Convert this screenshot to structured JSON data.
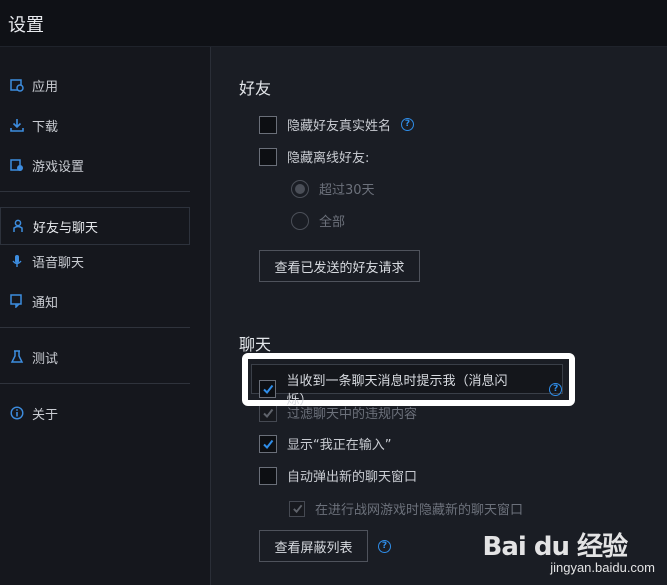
{
  "window": {
    "title": "设置"
  },
  "sidebar": {
    "items": [
      {
        "label": "应用",
        "icon": "app-icon"
      },
      {
        "label": "下载",
        "icon": "download-icon"
      },
      {
        "label": "游戏设置",
        "icon": "game-settings-icon"
      },
      {
        "label": "好友与聊天",
        "icon": "friend-icon",
        "active": true
      },
      {
        "label": "语音聊天",
        "icon": "microphone-icon"
      },
      {
        "label": "通知",
        "icon": "notification-icon"
      },
      {
        "label": "测试",
        "icon": "flask-icon"
      },
      {
        "label": "关于",
        "icon": "info-icon"
      }
    ]
  },
  "friends": {
    "heading": "好友",
    "hide_real_name": {
      "label": "隐藏好友真实姓名",
      "checked": false
    },
    "hide_offline": {
      "label": "隐藏离线好友:",
      "checked": false
    },
    "offline_options": [
      {
        "label": "超过30天",
        "selected": true
      },
      {
        "label": "全部",
        "selected": false
      }
    ],
    "sent_requests_button": "查看已发送的好友请求"
  },
  "chat": {
    "heading": "聊天",
    "notify_flash": {
      "label": "当收到一条聊天消息时提示我（消息闪烁）",
      "checked": true
    },
    "filter_profanity": {
      "label": "过滤聊天中的违规内容",
      "checked": true,
      "disabled": true
    },
    "show_typing": {
      "label": "显示“我正在输入”",
      "checked": true
    },
    "auto_popup": {
      "label": "自动弹出新的聊天窗口",
      "checked": false
    },
    "hide_in_game": {
      "label": "在进行战网游戏时隐藏新的聊天窗口",
      "checked": true,
      "disabled": true
    },
    "block_list_button": "查看屏蔽列表"
  },
  "watermark": {
    "text": "Bai du 经验",
    "url": "jingyan.baidu.com"
  },
  "colors": {
    "accent": "#2f8de8",
    "background": "#1a1d24",
    "highlight_frame": "#ffffff"
  }
}
